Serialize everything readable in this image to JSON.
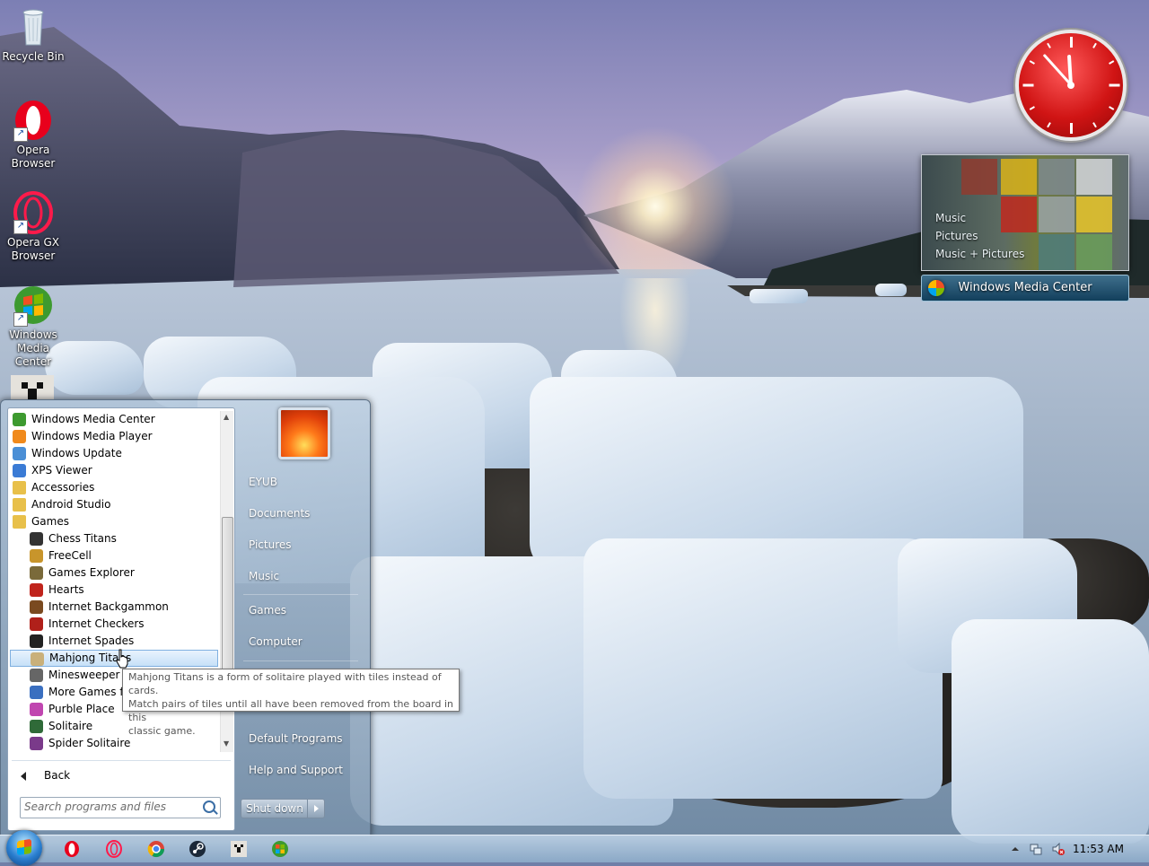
{
  "desktop": {
    "icons": [
      {
        "label": "Recycle Bin",
        "icon": "recycle-bin-icon"
      },
      {
        "label": "Opera Browser",
        "icon": "opera-icon"
      },
      {
        "label": "Opera GX Browser",
        "icon": "opera-gx-icon"
      },
      {
        "label": "Windows Media Center",
        "icon": "windows-media-center-icon"
      }
    ]
  },
  "gadgets": {
    "clock": {
      "hour": 11,
      "minute": 53
    },
    "media_center": {
      "menu": [
        "Music",
        "Pictures",
        "Music + Pictures"
      ],
      "title": "Windows Media Center"
    }
  },
  "start_menu": {
    "programs": [
      {
        "label": "Windows Media Center",
        "level": 0,
        "icon": "windows-media-center-icon"
      },
      {
        "label": "Windows Media Player",
        "level": 0,
        "icon": "media-player-icon"
      },
      {
        "label": "Windows Update",
        "level": 0,
        "icon": "windows-update-icon"
      },
      {
        "label": "XPS Viewer",
        "level": 0,
        "icon": "xps-viewer-icon"
      },
      {
        "label": "Accessories",
        "level": 0,
        "icon": "folder-icon"
      },
      {
        "label": "Android Studio",
        "level": 0,
        "icon": "folder-icon"
      },
      {
        "label": "Games",
        "level": 0,
        "icon": "folder-icon"
      },
      {
        "label": "Chess Titans",
        "level": 1,
        "icon": "chess-icon"
      },
      {
        "label": "FreeCell",
        "level": 1,
        "icon": "freecell-icon"
      },
      {
        "label": "Games Explorer",
        "level": 1,
        "icon": "games-explorer-icon"
      },
      {
        "label": "Hearts",
        "level": 1,
        "icon": "hearts-icon"
      },
      {
        "label": "Internet Backgammon",
        "level": 1,
        "icon": "backgammon-icon"
      },
      {
        "label": "Internet Checkers",
        "level": 1,
        "icon": "checkers-icon"
      },
      {
        "label": "Internet Spades",
        "level": 1,
        "icon": "spades-icon"
      },
      {
        "label": "Mahjong Titans",
        "level": 1,
        "icon": "mahjong-icon",
        "highlighted": true
      },
      {
        "label": "Minesweeper",
        "level": 1,
        "icon": "minesweeper-icon"
      },
      {
        "label": "More Games from Microsoft",
        "level": 1,
        "icon": "more-games-icon"
      },
      {
        "label": "Purble Place",
        "level": 1,
        "icon": "purble-place-icon"
      },
      {
        "label": "Solitaire",
        "level": 1,
        "icon": "solitaire-icon"
      },
      {
        "label": "Spider Solitaire",
        "level": 1,
        "icon": "spider-solitaire-icon"
      }
    ],
    "back_label": "Back",
    "search_placeholder": "Search programs and files",
    "user": "EYUB",
    "links": {
      "documents": "Documents",
      "pictures": "Pictures",
      "music": "Music",
      "games": "Games",
      "computer": "Computer",
      "default_programs": "Default Programs",
      "help": "Help and Support"
    },
    "shutdown": "Shut down"
  },
  "tooltip": {
    "lines": [
      "Mahjong Titans is a form of solitaire played with tiles instead of cards.",
      "Match pairs of tiles until all have been removed from the board in this",
      "classic game."
    ]
  },
  "taskbar": {
    "pinned": [
      "opera-icon",
      "opera-gx-icon",
      "chrome-icon",
      "steam-icon",
      "minecraft-icon",
      "windows-media-center-icon"
    ],
    "time": "11:53 AM"
  }
}
